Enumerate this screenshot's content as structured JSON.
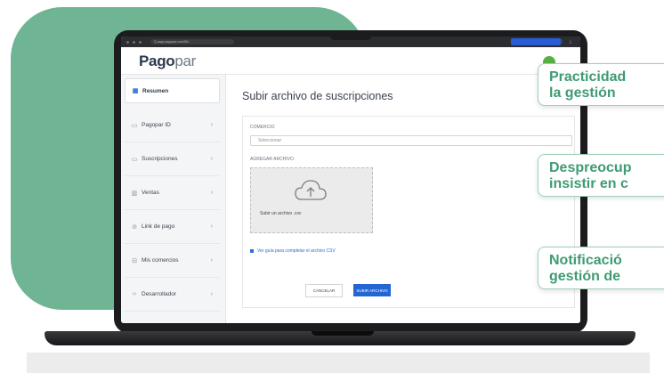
{
  "browser": {
    "url": "Q pago.pagopar.com/ID/r"
  },
  "app": {
    "logo_part1": "Pago",
    "logo_part2": "par"
  },
  "sidebar": {
    "items": [
      {
        "label": "Resumen",
        "icon": "grid-icon",
        "active": true
      },
      {
        "label": "Pagopar ID",
        "icon": "id-card-icon"
      },
      {
        "label": "Suscripciones",
        "icon": "calendar-icon"
      },
      {
        "label": "Ventas",
        "icon": "bar-chart-icon"
      },
      {
        "label": "Link de pago",
        "icon": "link-icon"
      },
      {
        "label": "Mis comercios",
        "icon": "store-icon"
      },
      {
        "label": "Desarrollador",
        "icon": "code-icon"
      }
    ]
  },
  "main": {
    "title": "Subir archivo de suscripciones",
    "comercio_label": "COMERCIO",
    "comercio_placeholder": "Seleccionar",
    "agregar_label": "AGREGAR ARCHIVO",
    "upload_text": "Subir un archivo .csv",
    "guide_link": "Ver guía para completar el archivo CSV",
    "cancel_label": "CANCELAR",
    "submit_label": "SUBIR ARCHIVO"
  },
  "callouts": [
    {
      "line1": "Practicidad",
      "line2": "la gestión"
    },
    {
      "line1": "Despreocup",
      "line2": "insistir en c"
    },
    {
      "line1": "Notificació",
      "line2": "gestión de"
    }
  ],
  "colors": {
    "brand_green": "#6fb593",
    "primary_blue": "#2365d1",
    "callout_text": "#3f9b74"
  }
}
